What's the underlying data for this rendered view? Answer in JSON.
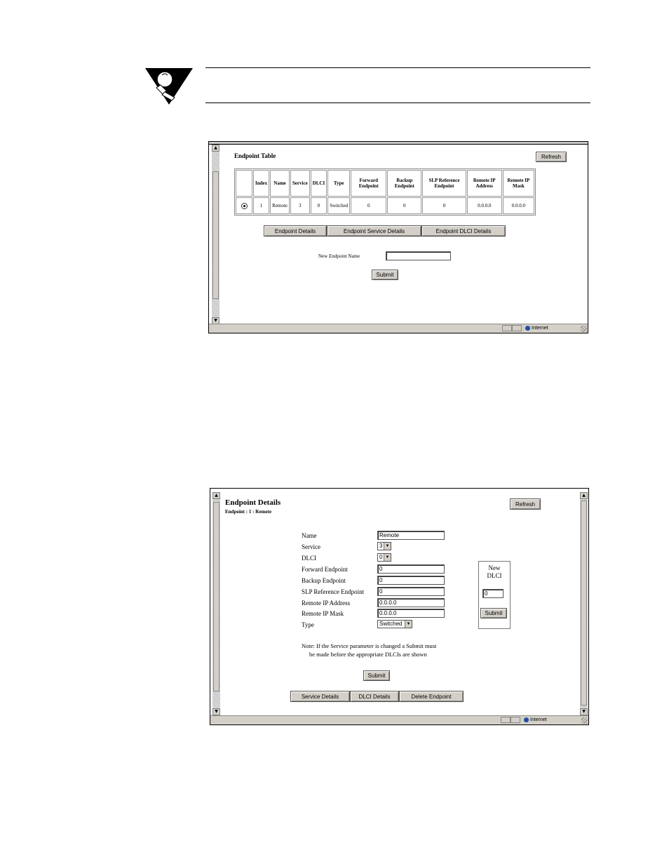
{
  "endpoint_table_window": {
    "title": "Endpoint Table",
    "refresh_label": "Refresh",
    "columns": [
      "",
      "Index",
      "Name",
      "Service",
      "DLCI",
      "Type",
      "Forward Endpoint",
      "Backup Endpoint",
      "SLP Reference Endpoint",
      "Remote IP Address",
      "Remote IP Mask"
    ],
    "row": {
      "index": "1",
      "name": "Remote",
      "service": "3",
      "dlci": "0",
      "type": "Switched",
      "forward_endpoint": "0",
      "backup_endpoint": "0",
      "slp_reference_endpoint": "0",
      "remote_ip_address": "0.0.0.0",
      "remote_ip_mask": "0.0.0.0"
    },
    "buttons": {
      "endpoint_details": "Endpoint Details",
      "endpoint_service_details": "Endpoint Service Details",
      "endpoint_dlci_details": "Endpoint DLCI Details",
      "submit": "Submit"
    },
    "new_endpoint_name_label": "New Endpoint Name",
    "new_endpoint_name_value": "",
    "status_zone": "Internet"
  },
  "endpoint_details_window": {
    "title": "Endpoint Details",
    "subtitle": "Endpoint : 1 : Remote",
    "refresh_label": "Refresh",
    "fields": {
      "name": {
        "label": "Name",
        "value": "Remote"
      },
      "service": {
        "label": "Service",
        "value": "3"
      },
      "dlci": {
        "label": "DLCI",
        "value": "0"
      },
      "forward_endpoint": {
        "label": "Forward Endpoint",
        "value": "0"
      },
      "backup_endpoint": {
        "label": "Backup Endpoint",
        "value": "0"
      },
      "slp_reference_endpoint": {
        "label": "SLP Reference Endpoint",
        "value": "0"
      },
      "remote_ip_address": {
        "label": "Remote IP Address",
        "value": "0.0.0.0"
      },
      "remote_ip_mask": {
        "label": "Remote IP Mask",
        "value": "0.0.0.0"
      },
      "type": {
        "label": "Type",
        "value": "Switched"
      }
    },
    "new_dlci": {
      "label_line1": "New",
      "label_line2": "DLCI",
      "value": "0",
      "submit_label": "Submit"
    },
    "note_line1": "Note:  If the Service parameter is changed a Submit must",
    "note_line2": "be made before the appropriate DLCIs are shown",
    "submit_label": "Submit",
    "buttons": {
      "service_details": "Service Details",
      "dlci_details": "DLCI Details",
      "delete_endpoint": "Delete Endpoint"
    },
    "status_zone": "Internet"
  },
  "icons": {
    "tip": "lightbulb-hand-icon",
    "scroll_up": "scroll-up-arrow-icon",
    "scroll_down": "scroll-down-arrow-icon",
    "select_arrow": "dropdown-arrow-icon",
    "zone": "globe-icon",
    "grip": "resize-grip-icon"
  }
}
